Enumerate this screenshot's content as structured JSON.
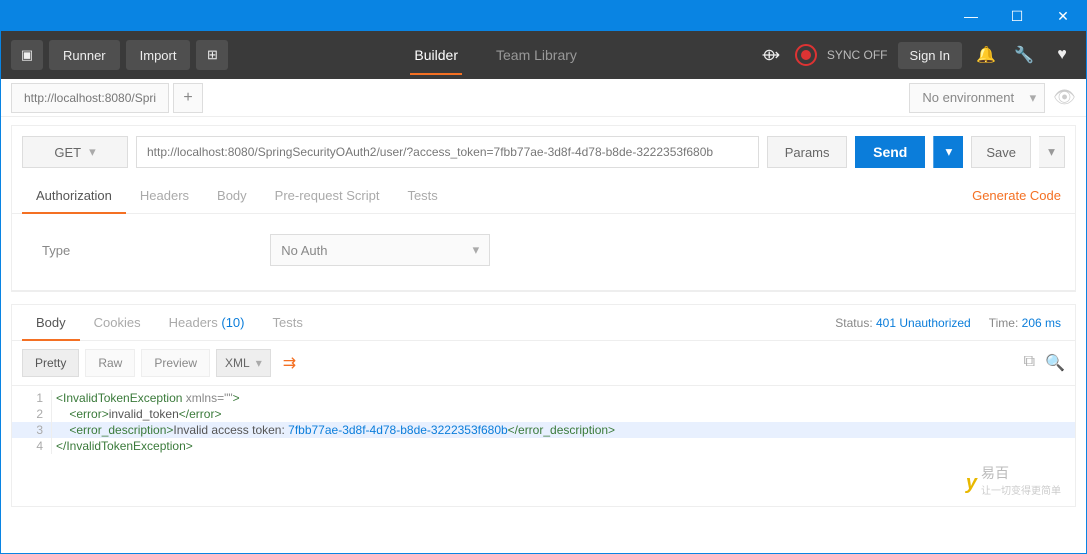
{
  "titlebar": {
    "min": "—",
    "max": "☐",
    "close": "✕"
  },
  "topbar": {
    "runner": "Runner",
    "import": "Import",
    "builder": "Builder",
    "team_library": "Team Library",
    "sync_off": "SYNC OFF",
    "sign_in": "Sign In"
  },
  "envbar": {
    "tab_label": "http://localhost:8080/Spri",
    "no_env": "No environment"
  },
  "request": {
    "method": "GET",
    "url": "http://localhost:8080/SpringSecurityOAuth2/user/?access_token=7fbb77ae-3d8f-4d78-b8de-3222353f680b",
    "params": "Params",
    "send": "Send",
    "save": "Save",
    "tabs": {
      "authorization": "Authorization",
      "headers": "Headers",
      "body": "Body",
      "prereq": "Pre-request Script",
      "tests": "Tests"
    },
    "gen_code": "Generate Code",
    "auth": {
      "type_label": "Type",
      "value": "No Auth"
    }
  },
  "response": {
    "tabs": {
      "body": "Body",
      "cookies": "Cookies",
      "headers": "Headers",
      "header_count": "(10)",
      "tests": "Tests"
    },
    "status_label": "Status:",
    "status_value": "401 Unauthorized",
    "time_label": "Time:",
    "time_value": "206 ms",
    "view": {
      "pretty": "Pretty",
      "raw": "Raw",
      "preview": "Preview",
      "format": "XML"
    },
    "lines": {
      "l1_tag_open": "<InvalidTokenException",
      "l1_attr": " xmlns=\"\"",
      "l1_tag_close": ">",
      "l2_indent": "    ",
      "l2_open": "<error>",
      "l2_text": "invalid_token",
      "l2_close": "</error>",
      "l3_indent": "    ",
      "l3_open": "<error_description>",
      "l3_text": "Invalid access token: ",
      "l3_token": "7fbb77ae-3d8f-4d78-b8de-3222353f680b",
      "l3_close": "</error_description>",
      "l4_close": "</InvalidTokenException>"
    }
  },
  "watermark": {
    "brand": "易百",
    "sub": "让一切变得更简单"
  }
}
